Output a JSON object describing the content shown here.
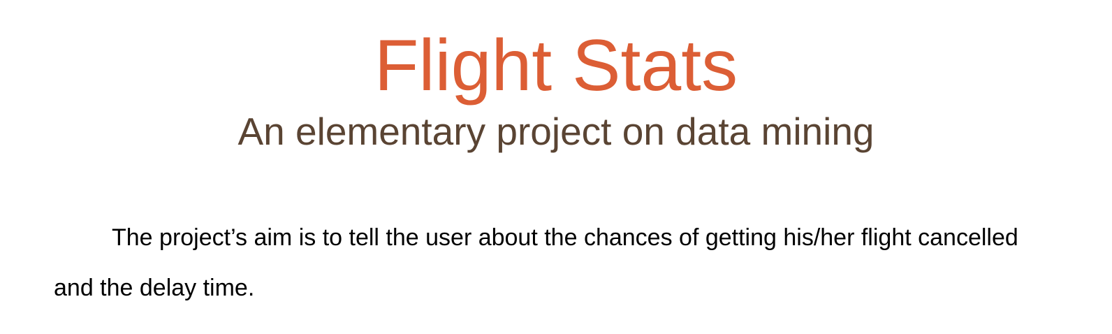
{
  "document": {
    "title": "Flight Stats",
    "subtitle": "An elementary project on data mining",
    "paragraph": "The project’s aim is to tell the user about the chances of getting his/her flight cancelled and the delay time."
  },
  "colors": {
    "title": "#dc5e35",
    "subtitle": "#5a4433",
    "body": "#000000"
  }
}
